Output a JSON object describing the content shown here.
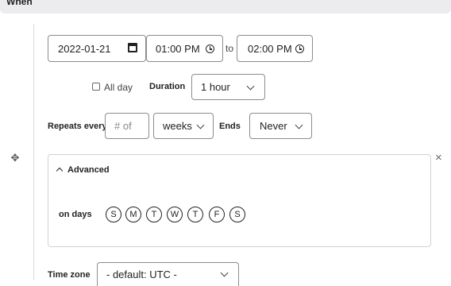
{
  "header": {
    "title": "When"
  },
  "date": {
    "value": "2022-01-21"
  },
  "start_time": {
    "value": "01:00 PM"
  },
  "to_label": "to",
  "end_time": {
    "value": "02:00 PM"
  },
  "all_day": {
    "label": "All day",
    "checked": false
  },
  "duration": {
    "label": "Duration",
    "value": "1 hour"
  },
  "repeats": {
    "label": "Repeats every",
    "placeholder": "# of",
    "unit": "weeks"
  },
  "ends": {
    "label": "Ends",
    "value": "Never"
  },
  "advanced": {
    "label": "Advanced",
    "close_glyph": "×",
    "on_days_label": "on days",
    "days": [
      "S",
      "M",
      "T",
      "W",
      "T",
      "F",
      "S"
    ]
  },
  "timezone": {
    "label": "Time zone",
    "value": "- default: UTC -"
  },
  "icons": {
    "drag": "drag-handle-icon",
    "calendar": "calendar-icon",
    "clock": "clock-icon"
  }
}
